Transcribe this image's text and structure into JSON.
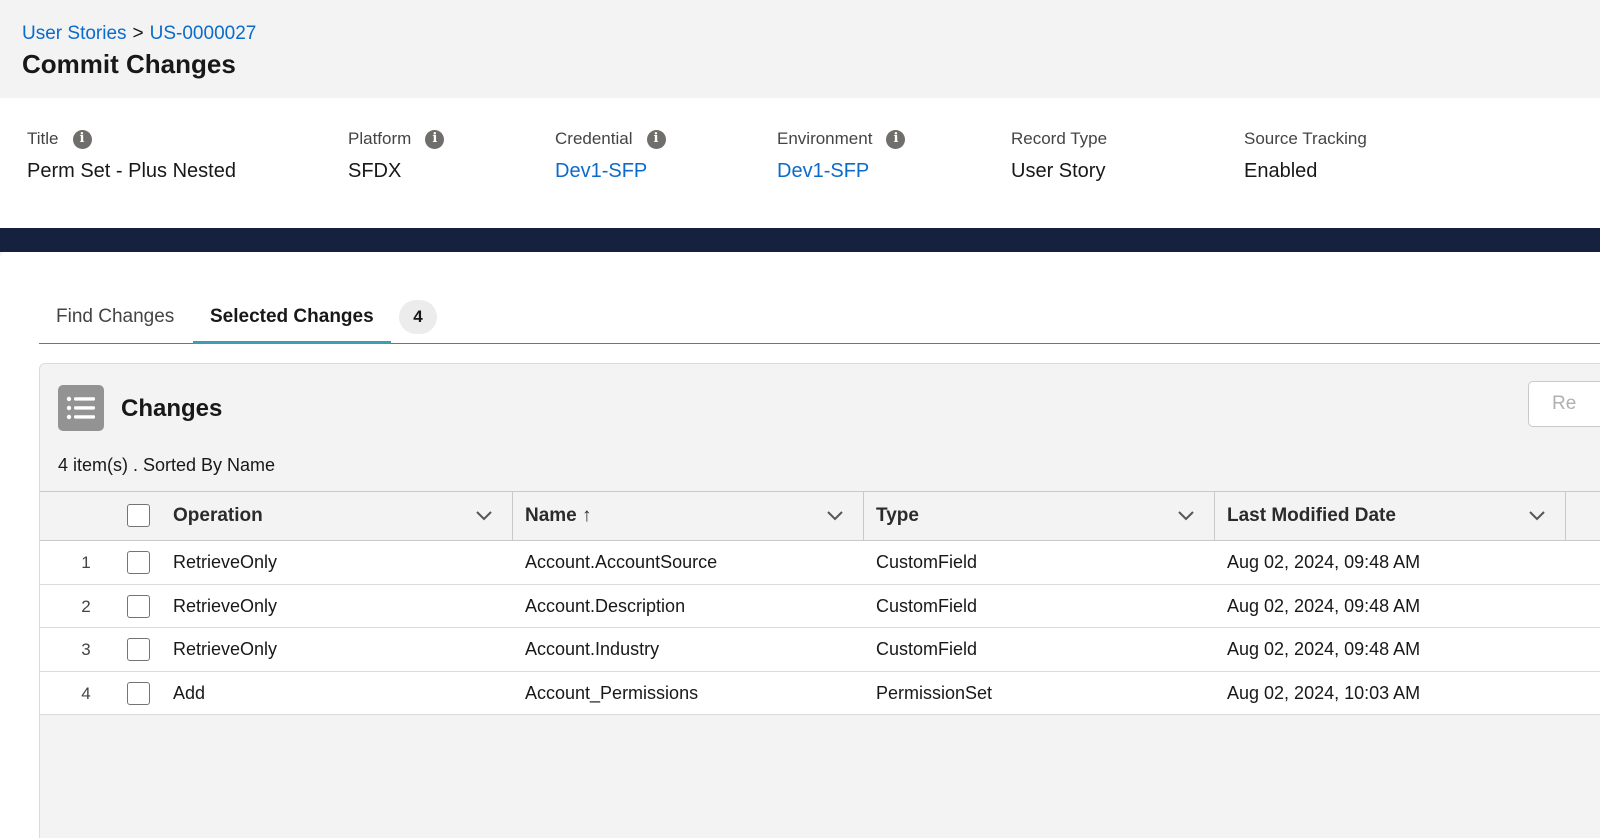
{
  "breadcrumb": {
    "parent": "User Stories",
    "separator": ">",
    "current": "US-0000027"
  },
  "page_title": "Commit Changes",
  "details": [
    {
      "label": "Title",
      "value": "Perm Set - Plus Nested"
    },
    {
      "label": "Platform",
      "value": "SFDX"
    },
    {
      "label": "Credential",
      "value": "Dev1-SFP"
    },
    {
      "label": "Environment",
      "value": "Dev1-SFP"
    },
    {
      "label": "Record Type",
      "value": "User Story"
    },
    {
      "label": "Source Tracking",
      "value": "Enabled"
    }
  ],
  "info_glyph": "i",
  "tabs": [
    {
      "label": "Find Changes"
    },
    {
      "label": "Selected Changes",
      "count": "4"
    }
  ],
  "card": {
    "title": "Changes",
    "button_label": "Re",
    "meta": "4 item(s) . Sorted By Name"
  },
  "table": {
    "columns": {
      "operation": "Operation",
      "name": "Name",
      "type": "Type",
      "date": "Last Modified Date"
    },
    "sort_arrow": "↑",
    "rows": [
      {
        "num": "1",
        "operation": "RetrieveOnly",
        "name": "Account.AccountSource",
        "type": "CustomField",
        "date": "Aug 02, 2024, 09:48 AM"
      },
      {
        "num": "2",
        "operation": "RetrieveOnly",
        "name": "Account.Description",
        "type": "CustomField",
        "date": "Aug 02, 2024, 09:48 AM"
      },
      {
        "num": "3",
        "operation": "RetrieveOnly",
        "name": "Account.Industry",
        "type": "CustomField",
        "date": "Aug 02, 2024, 09:48 AM"
      },
      {
        "num": "4",
        "operation": "Add",
        "name": "Account_Permissions",
        "type": "PermissionSet",
        "date": "Aug 02, 2024, 10:03 AM"
      }
    ]
  },
  "colors": {
    "link": "#0b6bcb",
    "band": "#16213f",
    "tab_underline": "#3d9db3",
    "icon_bg": "#939393"
  }
}
